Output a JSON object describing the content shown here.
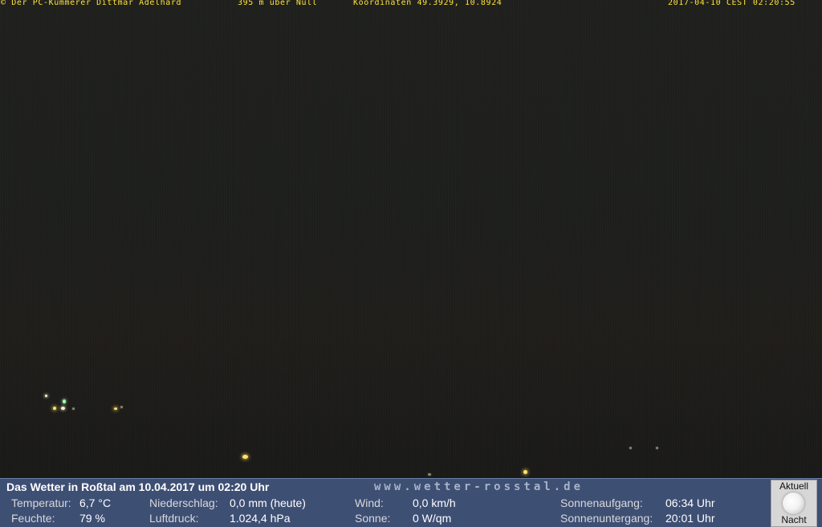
{
  "overlay": {
    "credit": "© Der PC-Kümmerer Dittmar Adelhard",
    "altitude": "395 m über Null",
    "coordinates": "Koordinaten 49.3929, 10.8924",
    "timestamp": "2017-04-10 CEST 02:20:55"
  },
  "weather": {
    "headline": "Das Wetter in Roßtal am 10.04.2017 um 02:20 Uhr",
    "website": "www.wetter-rosstal.de",
    "temperature_label": "Temperatur:",
    "temperature_value": "6,7 °C",
    "humidity_label": "Feuchte:",
    "humidity_value": "79 %",
    "precip_label": "Niederschlag:",
    "precip_value": "0,0 mm (heute)",
    "pressure_label": "Luftdruck:",
    "pressure_value": "1.024,4 hPa",
    "wind_label": "Wind:",
    "wind_value": "0,0 km/h",
    "sun_label": "Sonne:",
    "sun_value": "0 W/qm",
    "sunrise_label": "Sonnenaufgang:",
    "sunrise_value": "06:34 Uhr",
    "sunset_label": "Sonnenuntergang:",
    "sunset_value": "20:01 Uhr"
  },
  "moon": {
    "top_label": "Aktuell",
    "bottom_label": "Nacht",
    "icon": "full-moon-icon"
  },
  "colors": {
    "overlay_text": "#ffe23a",
    "panel_background": "#3e4f74"
  }
}
